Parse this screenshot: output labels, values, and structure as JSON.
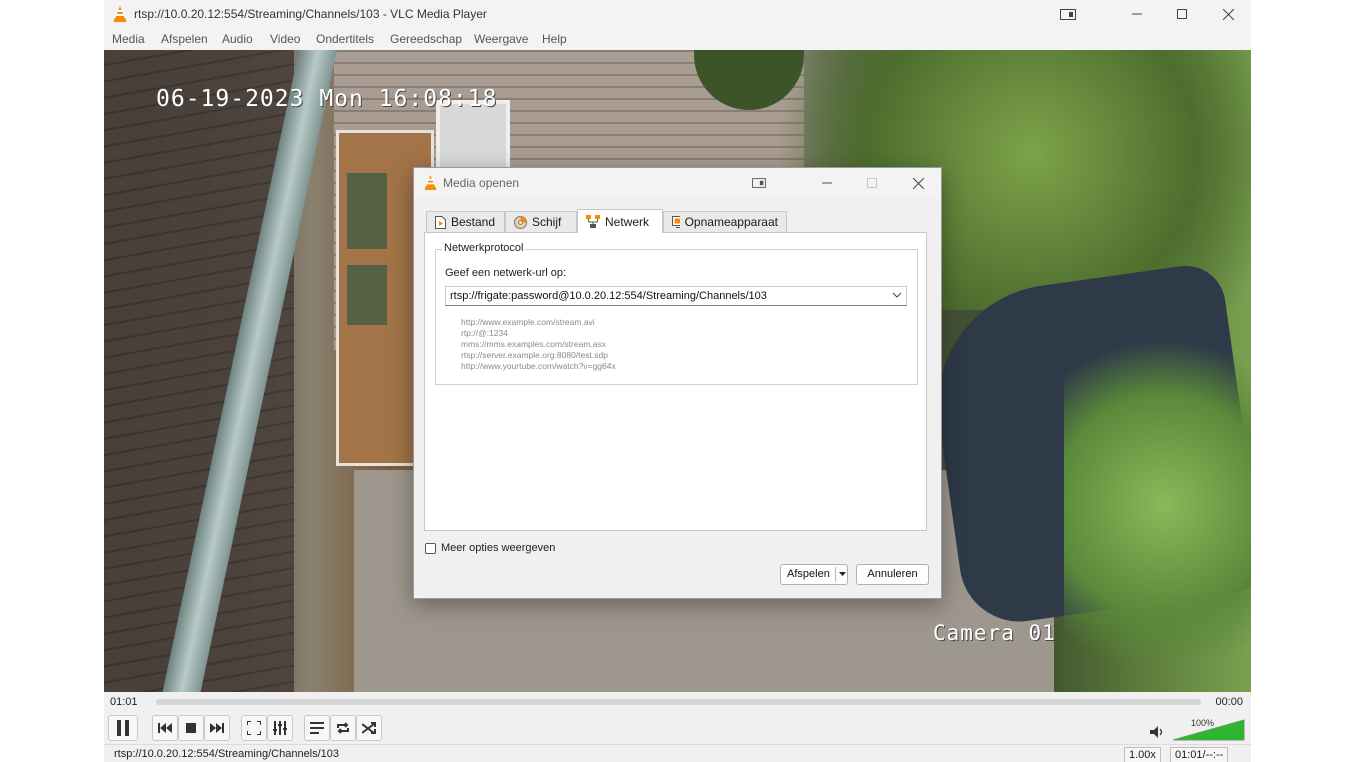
{
  "window": {
    "title": "rtsp://10.0.20.12:554/Streaming/Channels/103 - VLC Media Player"
  },
  "menu": [
    "Media",
    "Afspelen",
    "Audio",
    "Video",
    "Ondertitels",
    "Gereedschap",
    "Weergave",
    "Help"
  ],
  "video": {
    "osd_date": "06-19-2023 Mon 16:08:18",
    "osd_camera": "Camera 01"
  },
  "dialog": {
    "title": "Media openen",
    "tabs": [
      {
        "label": "Bestand",
        "icon": "file-play-icon"
      },
      {
        "label": "Schijf",
        "icon": "disc-icon"
      },
      {
        "label": "Netwerk",
        "icon": "network-icon",
        "active": true
      },
      {
        "label": "Opnameapparaat",
        "icon": "capture-device-icon"
      }
    ],
    "group_title": "Netwerkprotocol",
    "url_label": "Geef een netwerk-url op:",
    "url_value": "rtsp://frigate:password@10.0.20.12:554/Streaming/Channels/103",
    "examples": [
      "http://www.example.com/stream.avi",
      "rtp://@:1234",
      "mms://mms.examples.com/stream.asx",
      "rtsp://server.example.org:8080/test.sdp",
      "http://www.yourtube.com/watch?v=gg64x"
    ],
    "more_options": "Meer opties weergeven",
    "more_options_checked": false,
    "play_button": "Afspelen",
    "cancel_button": "Annuleren"
  },
  "player": {
    "elapsed": "01:01",
    "total": "00:00",
    "volume_label": "100%",
    "volume_level": 1.0,
    "volume_color": "#2fb52f"
  },
  "status": {
    "text": "rtsp://10.0.20.12:554/Streaming/Channels/103",
    "speed": "1.00x",
    "time": "01:01/--:--"
  },
  "colors": {
    "vlc_orange": "#f48b00",
    "accent": "#0067c0"
  }
}
